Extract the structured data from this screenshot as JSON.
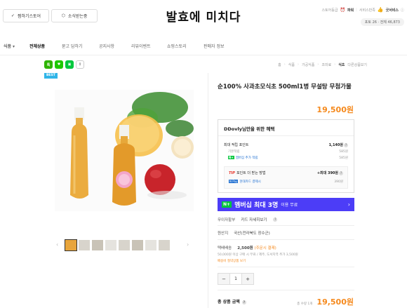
{
  "header": {
    "follow_label": "찜하기스토어",
    "notify_label": "소식받는중",
    "store_name": "발효에 미치다",
    "grade_label": "스토어등급",
    "grade_value": "파워",
    "service_label": "서비스만족",
    "service_value": "굿서비스",
    "stats_text": "포토 26 · 전체 46,873"
  },
  "nav": {
    "category": "식품",
    "all_products": "전체상품",
    "items": [
      "묻고 답하기",
      "공지사항",
      "리뷰이벤트",
      "쇼핑스토리",
      "판매자 정보"
    ]
  },
  "breadcrumb": [
    "홈",
    "식품",
    "가공식품",
    "조미료",
    "식초"
  ],
  "breadcrumb_extra": "다른상품보기",
  "badge": "BEST",
  "product": {
    "name": "순100% 사과초모식초 500ml1병 무설탕 무첨가물",
    "price": "19,500원"
  },
  "benefit": {
    "title": "DDovly님만을 위한 혜택",
    "max_points_label": "최대 적립 포인트",
    "max_points_value": "1,140원",
    "base_label": "기본적립",
    "base_value": "585원",
    "membership_label": "멤버십 추가 적립",
    "membership_value": "585원",
    "tip_label": "포인트 더 받는 방법",
    "tip_prefix": "TIP",
    "tip_value": "+최대 390원",
    "card_label": "현대카드 결제시",
    "card_value": "390원"
  },
  "banner": {
    "badge": "N+",
    "text": "멤버십 최대 3명",
    "suffix": "이용 무료"
  },
  "payment": {
    "label": "무이자할부",
    "link": "카드 자세히보기"
  },
  "origin": {
    "label": "원산지",
    "value": "국산(전라북도 장수군)"
  },
  "shipping": {
    "label": "택배배송",
    "fee": "2,500원",
    "note": "(주문시 결제)",
    "line2": "50,000원 이상 구매 시 무료 / 제주, 도서지역 추가 3,500원",
    "line3": "배송비 절약상품 보기"
  },
  "quantity": {
    "minus": "−",
    "value": "1",
    "plus": "+"
  },
  "total": {
    "label": "총 상품 금액",
    "count": "총 수량 1개",
    "amount": "19,500원"
  },
  "colors": {
    "accent": "#f5891c",
    "naver_green": "#00c73c",
    "banner_purple": "#4c3df7",
    "best_blue": "#30b5e8"
  }
}
